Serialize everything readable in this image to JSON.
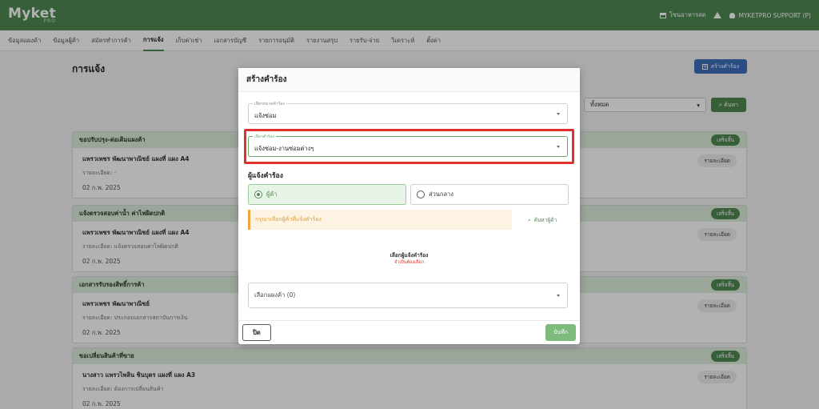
{
  "header": {
    "logo": "Myket",
    "logo_sub": "PRO",
    "store": "โซนอาหารสด",
    "user": "MYKETPRO SUPPORT (P)"
  },
  "nav": [
    "ข้อมูลแผงค้า",
    "ข้อมูลผู้ค้า",
    "สมัครทำการค้า",
    "การแจ้ง",
    "เก็บค่าเช่า",
    "เอกสารบัญชี",
    "รายการอนุมัติ",
    "รายงานสรุป",
    "รายรับ-จ่าย",
    "วิเคราะห์",
    "ตั้งค่า"
  ],
  "page": {
    "title": "การแจ้ง",
    "create_label": "สร้างคำร้อง",
    "filter_value": "ทั้งหมด",
    "search_label": "ค้นหา"
  },
  "cards": [
    {
      "title": "ขอปรับปรุง-ต่อเติมแผงค้า",
      "badge": "เสร็จสิ้น",
      "name": "แพรวเพชร พัฒนาพาณิชย์ แผงที่ แผง A4",
      "detail": "รายละเอียด: -",
      "date": "02 ก.พ. 2025",
      "btn": "รายละเอียด"
    },
    {
      "title": "แจ้งตรวจสอบค่าน้ำ ค่าไฟผิดปกติ",
      "badge": "เสร็จสิ้น",
      "name": "แพรวเพชร พัฒนาพาณิชย์ แผงที่ แผง A4",
      "detail": "รายละเอียด: แจ้งตรวจสอบค่าไฟผิดปกติ",
      "date": "02 ก.พ. 2025",
      "btn": "รายละเอียด"
    },
    {
      "title": "เอกสารรับรองสิทธิ์การค้า",
      "badge": "เสร็จสิ้น",
      "name": "แพรวเพชร พัฒนาพาณิชย์",
      "detail": "รายละเอียด: ประกอบเอกสารสถาบันการเงิน",
      "date": "02 ก.พ. 2025",
      "btn": "รายละเอียด"
    },
    {
      "title": "ขอเปลี่ยนสินค้าที่ขาย",
      "badge": "เสร็จสิ้น",
      "name": "นางสาว แพรวไพลิน ชินบุตร แผงที่ แผง A3",
      "detail": "รายละเอียด: ต้องการเปลี่ยนสินค้า",
      "date": "02 ก.พ. 2025",
      "btn": "รายละเอียด"
    }
  ],
  "modal": {
    "title": "สร้างคำร้อง",
    "category_legend": "เลือกหมวดคำร้อง",
    "category_value": "แจ้งซ่อม",
    "request_legend": "เลือกคำร้อง",
    "request_value": "แจ้งซ่อม-งานซ่อมต่างๆ",
    "requester_title": "ผู้แจ้งคำร้อง",
    "option_vendor": "ผู้ค้า",
    "option_central": "ส่วนกลาง",
    "warning": "กรุณาเลือกผู้ค้าที่แจ้งคำร้อง",
    "search_vendor": "ค้นหาผู้ค้า",
    "select_requester": "เลือกผู้แจ้งคำร้อง",
    "required": "จำเป็นต้องเลือก",
    "stall_select": "เลือกแผงค้า (0)",
    "close": "ปิด",
    "save": "บันทึก"
  },
  "colors": {
    "primary": "#4f8a52",
    "accent_blue": "#3f6fbd",
    "highlight": "#e0322a",
    "warning": "#f0a43c"
  }
}
